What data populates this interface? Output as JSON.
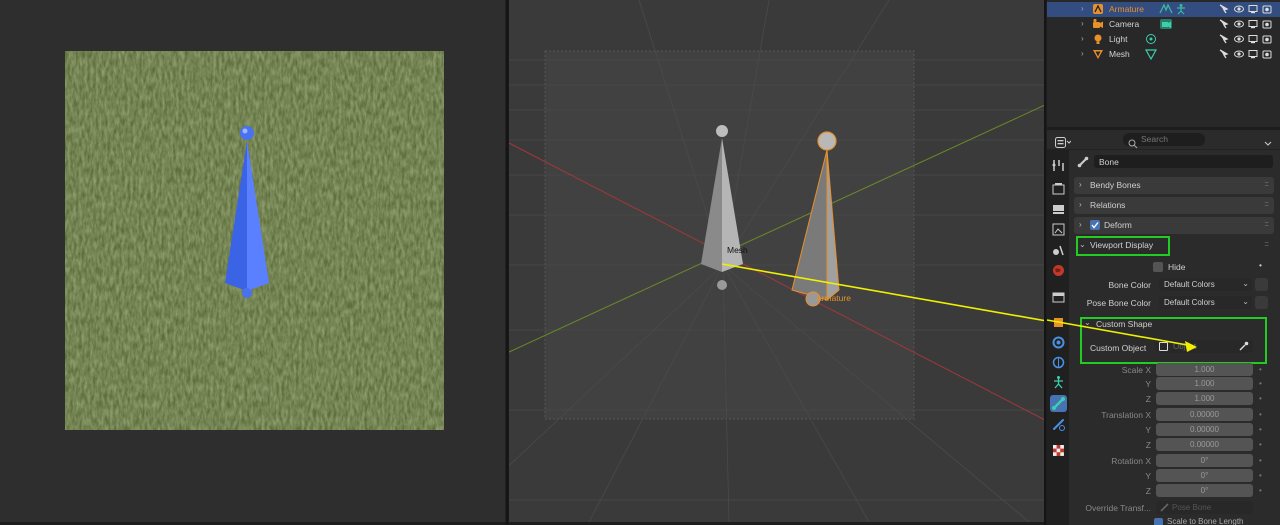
{
  "outliner": {
    "rows": [
      {
        "label": "Armature",
        "selected": true,
        "icon": "armature-icon",
        "sub_icon": "armature-data-icon"
      },
      {
        "label": "Camera",
        "selected": false,
        "icon": "camera-icon",
        "sub_icon": "camera-data-icon"
      },
      {
        "label": "Light",
        "selected": false,
        "icon": "light-icon",
        "sub_icon": "light-data-icon"
      },
      {
        "label": "Mesh",
        "selected": false,
        "icon": "mesh-icon",
        "sub_icon": "mesh-data-icon"
      }
    ]
  },
  "properties": {
    "search_placeholder": "Search",
    "context_title": "Bone",
    "panels": {
      "bendy_bones": "Bendy Bones",
      "relations": "Relations",
      "deform": "Deform",
      "viewport_display": "Viewport Display",
      "custom_shape": "Custom Shape"
    },
    "hide_label": "Hide",
    "bone_color_label": "Bone Color",
    "bone_color_value": "Default Colors",
    "pose_bone_color_label": "Pose Bone Color",
    "pose_bone_color_value": "Default Colors",
    "custom_object_label": "Custom Object",
    "custom_object_placeholder": "Object",
    "scale_x_label": "Scale X",
    "y_label": "Y",
    "z_label": "Z",
    "scale_x": "1.000",
    "scale_y": "1.000",
    "scale_z": "1.000",
    "translation_x_label": "Translation X",
    "translation_x": "0.00000",
    "translation_y": "0.00000",
    "translation_z": "0.00000",
    "rotation_label": "Rotation X",
    "rotation_x": "0°",
    "rotation_y": "0°",
    "rotation_z": "0°",
    "override_label": "Override Transf...",
    "override_placeholder": "Pose Bone",
    "scale_to_bone_label": "Scale to Bone Length"
  },
  "viewport": {
    "mesh_label": "Mesh",
    "armature_label": "Armature"
  },
  "colors": {
    "highlight": "#22cc22",
    "selection": "#334d80",
    "armature_orange": "#e8902a",
    "arrow_yellow": "#f0f000",
    "bone_blue": "#4169e1"
  }
}
